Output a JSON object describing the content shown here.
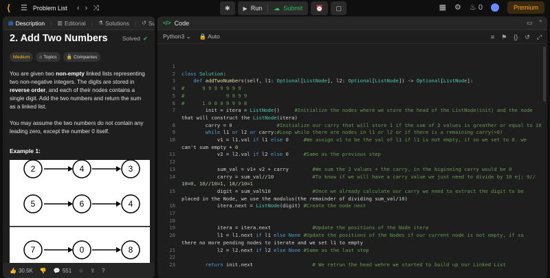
{
  "topbar": {
    "problem_list": "Problem List",
    "run": "Run",
    "submit": "Submit",
    "streak": "0",
    "premium": "Premium"
  },
  "left_tabs": [
    {
      "label": "Description",
      "icon": "description-icon"
    },
    {
      "label": "Editorial",
      "icon": "editorial-icon"
    },
    {
      "label": "Solutions",
      "icon": "solutions-icon"
    },
    {
      "label": "Submi",
      "icon": "submissions-icon"
    }
  ],
  "problem": {
    "title": "2. Add Two Numbers",
    "solved": "Solved",
    "difficulty": "Medium",
    "topics": "Topics",
    "companies": "Companies",
    "para1_a": "You are given two ",
    "para1_b": "non-empty",
    "para1_c": " linked lists representing two non-negative integers. The digits are stored in ",
    "para1_d": "reverse order",
    "para1_e": ", and each of their nodes contains a single digit. Add the two numbers and return the sum as a linked list.",
    "para2": "You may assume the two numbers do not contain any leading zero, except the number 0 itself.",
    "example": "Example 1:",
    "diagram": {
      "row1": [
        "2",
        "4",
        "3"
      ],
      "row2": [
        "5",
        "6",
        "4"
      ],
      "row3": [
        "7",
        "0",
        "8"
      ]
    }
  },
  "footer": {
    "likes": "30.5K",
    "comments": "551"
  },
  "code_panel": {
    "title": "Code",
    "language": "Python3",
    "mode": "Auto"
  },
  "code_lines": [
    {
      "n": "1",
      "t": ""
    },
    {
      "n": "2",
      "t": "class Solution:"
    },
    {
      "n": "3",
      "t": "    def addTwoNumbers(self, l1: Optional[ListNode], l2: Optional[ListNode]) -> Optional[ListNode]:"
    },
    {
      "n": "4",
      "t": "#      9 9 9 9 9 9 9"
    },
    {
      "n": "5",
      "t": "#              9 9 9 9"
    },
    {
      "n": "6",
      "t": "#      1 0 0 0 9 9 9 8"
    },
    {
      "n": "7",
      "t": "        init = itera = ListNode()     #Initialize the nodes where we store the head of the ListNode(init) and the node"
    },
    {
      "n": "",
      "t": "that will construct the ListNode(itera)"
    },
    {
      "n": "8",
      "t": "        carry = 0               #Initialize our carry that will store 1 if the sum of 2 values is greather or equal to 10"
    },
    {
      "n": "9",
      "t": "        while l1 or l2 or carry:#Loop while there are nodes in l1 or l2 or if there is a remaining carry(>0)"
    },
    {
      "n": "10",
      "t": "            v1 = l1.val if l1 else 0     #We assign v1 to be the val of l1 if l1 is not empty, if so we set to 0. we"
    },
    {
      "n": "",
      "t": "can't sum empty + 0"
    },
    {
      "n": "11",
      "t": "            v2 = l2.val if l2 else 0     #Same as the previous step"
    },
    {
      "n": "12",
      "t": ""
    },
    {
      "n": "13",
      "t": "            sum_val = v1+ v2 + carry        #We sum the 2 values + the carry, in the biginning carry would be 0"
    },
    {
      "n": "14",
      "t": "            carry = sum_val//10             #To know if we will have a carry value we just need to divide by 10 ej: 9//"
    },
    {
      "n": "",
      "t": "10=0, 10//10=1, 18//10=1"
    },
    {
      "n": "15",
      "t": "            digit = sum_val%10              #Once we already calculate our carry we need to extract the digit to be"
    },
    {
      "n": "",
      "t": "placed in the Node, we use the modulus(the remainder of dividing sum_val/10)"
    },
    {
      "n": "16",
      "t": "            itera.next = ListNode(digit) #Create the node next"
    },
    {
      "n": "17",
      "t": ""
    },
    {
      "n": "18",
      "t": ""
    },
    {
      "n": "19",
      "t": "            itera = itera.next              #Update the positions of the Node itera"
    },
    {
      "n": "20",
      "t": "            l1 = l1.next if l1 else None #Update the positions of the Nodes if our current node is not empty, if so"
    },
    {
      "n": "",
      "t": "there no more pending nodes to iterate and we set l1 to empty"
    },
    {
      "n": "21",
      "t": "            l2 = l2.next if l2 else None #Same as the last step"
    },
    {
      "n": "22",
      "t": ""
    },
    {
      "n": "23",
      "t": "        return init.next                    # We retrun the head wehre we started to build up our Linked List"
    }
  ]
}
